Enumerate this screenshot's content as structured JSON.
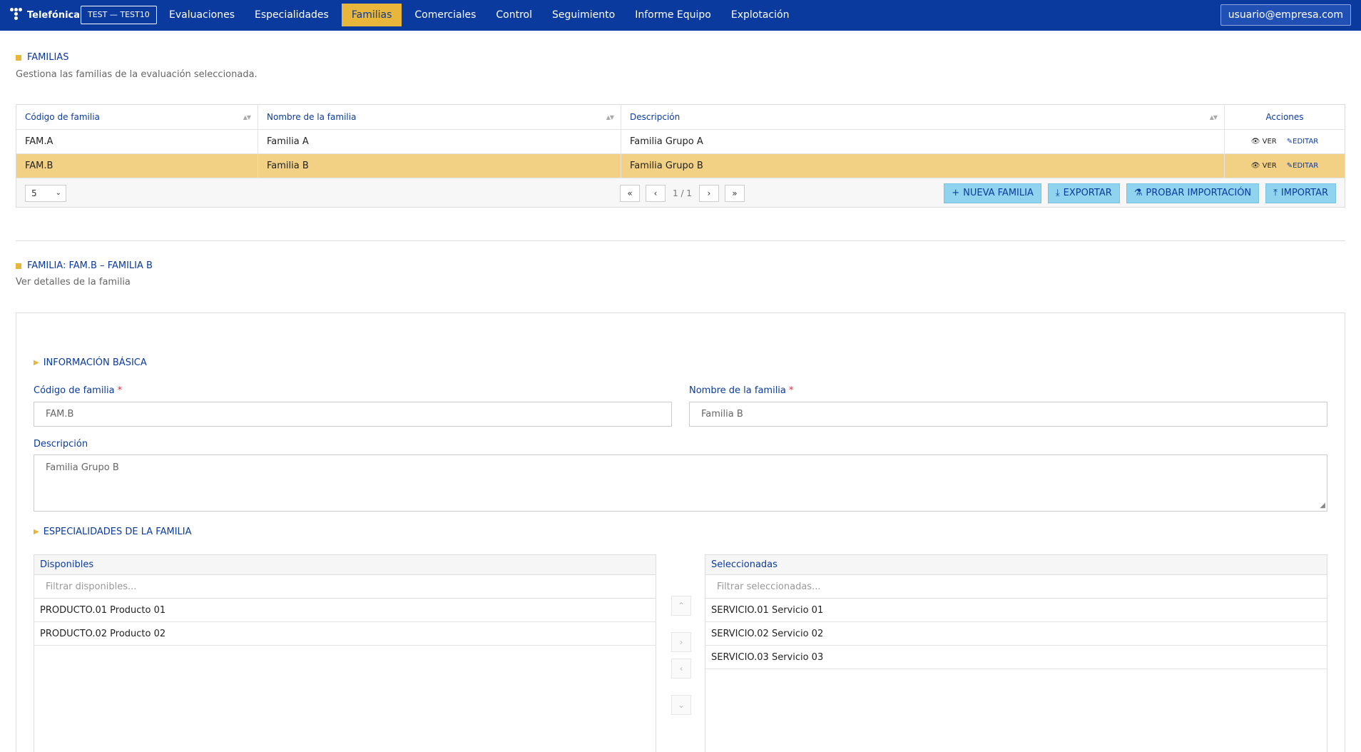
{
  "app": {
    "brand": "Telefónica",
    "env_badge": "TEST — TEST10",
    "nav": [
      {
        "label": "Evaluaciones",
        "active": false
      },
      {
        "label": "Especialidades",
        "active": false
      },
      {
        "label": "Familias",
        "active": true
      },
      {
        "label": "Comerciales",
        "active": false
      },
      {
        "label": "Control",
        "active": false
      },
      {
        "label": "Seguimiento",
        "active": false
      },
      {
        "label": "Informe Equipo",
        "active": false
      },
      {
        "label": "Explotación",
        "active": false
      }
    ],
    "user": "usuario@empresa.com"
  },
  "list": {
    "title": "FAMILIAS",
    "subtitle": "Gestiona las familias de la evaluación seleccionada.",
    "columns": [
      "Código de familia",
      "Nombre de la familia",
      "Descripción",
      "Acciones"
    ],
    "rows": [
      {
        "code": "FAM.A",
        "name": "Familia A",
        "description": "Familia Grupo A",
        "selected": false
      },
      {
        "code": "FAM.B",
        "name": "Familia B",
        "description": "Familia Grupo B",
        "selected": true
      }
    ],
    "row_actions": {
      "view": "VER",
      "edit": "EDITAR"
    },
    "page_size": "5",
    "page_info": "1 / 1",
    "buttons": {
      "new": "NUEVA FAMILIA",
      "export": "EXPORTAR",
      "test_import": "PROBAR IMPORTACIÓN",
      "import": "IMPORTAR"
    }
  },
  "detail": {
    "title": "FAMILIA: FAM.B – FAMILIA B",
    "subtitle": "Ver detalles de la familia",
    "basic_info_title": "INFORMACIÓN BÁSICA",
    "code_label": "Código de familia",
    "code_value": "FAM.B",
    "name_label": "Nombre de la familia",
    "name_value": "Familia B",
    "desc_label": "Descripción",
    "desc_value": "Familia Grupo B",
    "required_mark": "*",
    "specialties_title": "ESPECIALIDADES DE LA FAMILIA",
    "available": {
      "header": "Disponibles",
      "filter_placeholder": "Filtrar disponibles...",
      "items": [
        "PRODUCTO.01  Producto 01",
        "PRODUCTO.02  Producto 02"
      ]
    },
    "selected": {
      "header": "Seleccionadas",
      "filter_placeholder": "Filtrar seleccionadas...",
      "items": [
        "SERVICIO.01  Servicio 01",
        "SERVICIO.02  Servicio 02",
        "SERVICIO.03  Servicio 03"
      ]
    }
  },
  "colors": {
    "primary": "#0b3a9e",
    "accent": "#e8b63a",
    "selected_row": "#f3d184",
    "action_button": "#8fd3ee"
  }
}
